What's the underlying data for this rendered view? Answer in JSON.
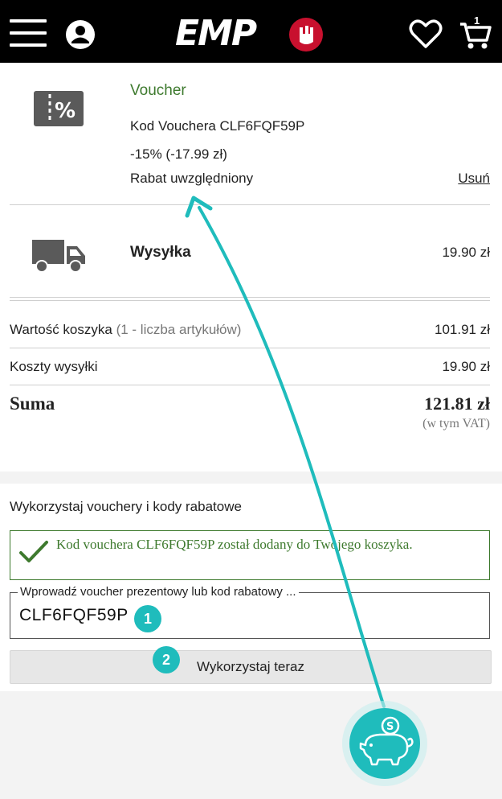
{
  "header": {
    "logo_text": "EMP",
    "cart_count": "1",
    "icons": [
      "menu-icon",
      "user-icon",
      "heart-icon",
      "cart-icon"
    ]
  },
  "voucher": {
    "title": "Voucher",
    "code_line": "Kod Vouchera CLF6FQF59P",
    "discount": "-15% (-17.99 zł)",
    "status": "Rabat uwzględniony",
    "remove_label": "Usuń"
  },
  "shipping": {
    "label": "Wysyłka",
    "price": "19.90 zł"
  },
  "summary": {
    "cart_value_label": "Wartość koszyka",
    "cart_value_count": "(1 - liczba artykułów)",
    "cart_value": "101.91 zł",
    "shipping_label": "Koszty wysyłki",
    "shipping_value": "19.90 zł",
    "total_label": "Suma",
    "total_value": "121.81 zł",
    "vat_note": "(w tym VAT)"
  },
  "voucher_form": {
    "title": "Wykorzystaj vouchery i kody rabatowe",
    "success_message": "Kod vouchera CLF6FQF59P został dodany do Twojego koszyka.",
    "input_label": "Wprowadź voucher prezentowy lub kod rabatowy ...",
    "input_value": "CLF6FQF59P",
    "button_label": "Wykorzystaj teraz"
  },
  "annotations": {
    "step1": "1",
    "step2": "2",
    "accent_color": "#1fbcbc"
  },
  "colors": {
    "brand_black": "#000000",
    "success_green": "#3e7a2e"
  }
}
